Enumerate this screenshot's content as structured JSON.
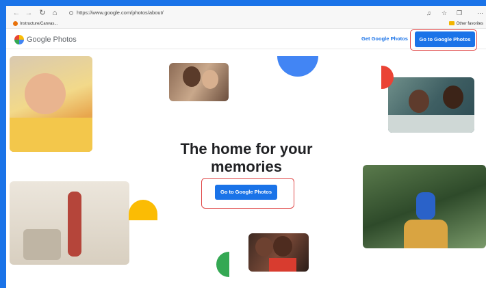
{
  "browser": {
    "url": "https://www.google.com/photos/about/",
    "favorites": {
      "item": "Instructure/Canvas...",
      "other": "Other favorites"
    },
    "icons": [
      "back-icon",
      "forward-icon",
      "refresh-icon",
      "home-icon",
      "read-aloud-icon",
      "favorites-icon",
      "collections-icon",
      "more-icon"
    ]
  },
  "header": {
    "logo_text": "Google Photos",
    "get_link": "Get Google Photos",
    "cta_label": "Go to Google Photos"
  },
  "hero": {
    "title": "The home for your memories",
    "cta_label": "Go to Google Photos"
  },
  "colors": {
    "brand_blue": "#1a73e8",
    "google_red": "#ea4335",
    "google_yellow": "#fbbc04",
    "google_green": "#34a853",
    "highlight_red": "#e04848"
  }
}
